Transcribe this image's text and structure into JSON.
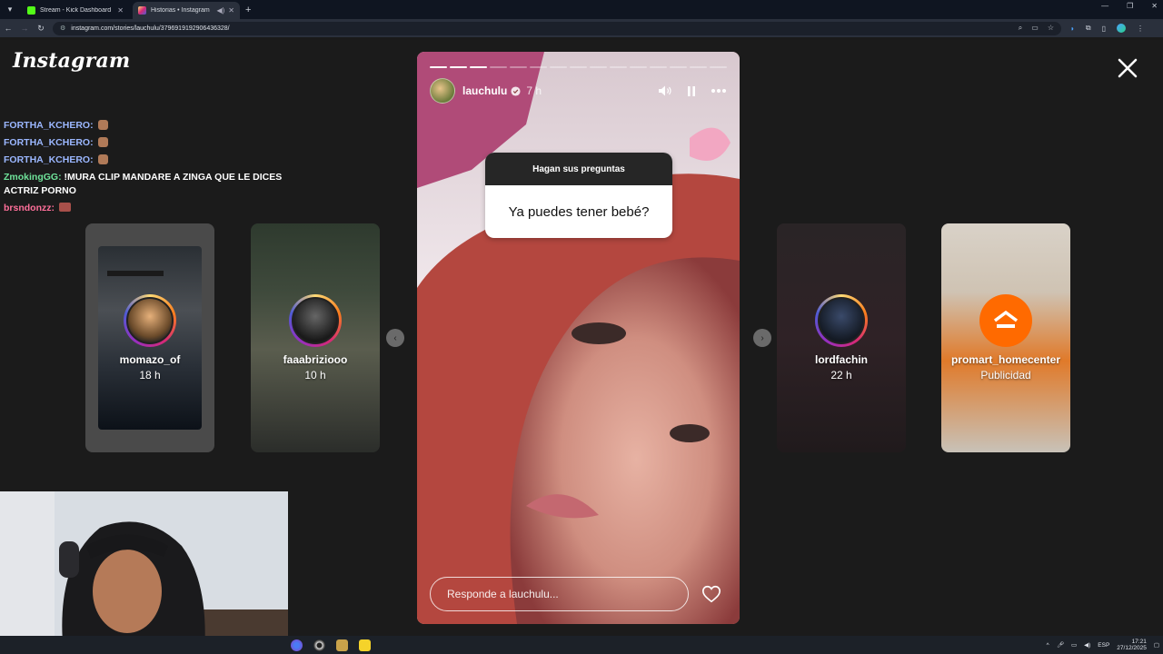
{
  "browser": {
    "tabs": [
      {
        "title": "Stream - Kick Dashboard",
        "favicon_color": "#53fc18",
        "active": false
      },
      {
        "title": "Historias • Instagram",
        "favicon_color": "#e1306c",
        "active": true
      }
    ],
    "url": "instagram.com/stories/lauchulu/3796919192906436328/"
  },
  "instagram": {
    "logo": "Instagram"
  },
  "chat": [
    {
      "user": "FORTHA_KCHERO:",
      "message": "",
      "color": "#9bb7ff"
    },
    {
      "user": "FORTHA_KCHERO:",
      "message": "",
      "color": "#9bb7ff"
    },
    {
      "user": "FORTHA_KCHERO:",
      "message": "",
      "color": "#9bb7ff"
    },
    {
      "user": "ZmokingGG:",
      "message": "!MURA CLIP MANDARE A ZINGA QUE LE DICES ACTRIZ PORNO",
      "color": "#6fe39a"
    },
    {
      "user": "brsndonzz:",
      "message": "",
      "color": "#ff6f9a"
    }
  ],
  "side_stories": [
    {
      "username": "momazo_of",
      "time": "18 h"
    },
    {
      "username": "faaabriziooo",
      "time": "10 h"
    },
    {
      "username": "lordfachin",
      "time": "22 h"
    },
    {
      "username": "promart_homecenter",
      "time": "Publicidad"
    }
  ],
  "story": {
    "username": "lauchulu",
    "time_ago": "7 h",
    "question_header": "Hagan sus preguntas",
    "question_answer": "Ya puedes tener bebé?",
    "reply_placeholder": "Responde a lauchulu...",
    "progress_segments": 15,
    "progress_done": 3
  },
  "taskbar": {
    "lang": "ESP",
    "time": "17:21",
    "date": "27/12/2025"
  }
}
